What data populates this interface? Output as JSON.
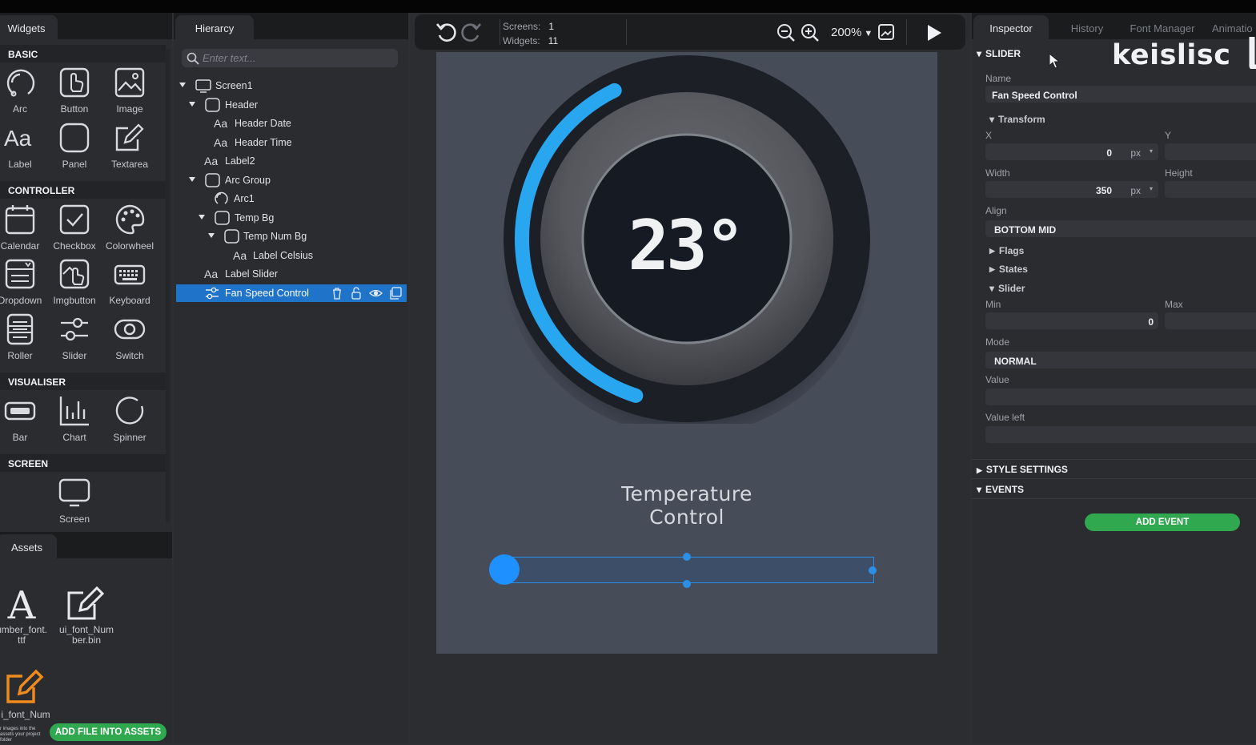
{
  "widgets": {
    "tab": "Widgets",
    "sections": {
      "basic": "BASIC",
      "controller": "CONTROLLER",
      "visualiser": "VISUALISER",
      "screen": "SCREEN"
    },
    "basic": [
      "Arc",
      "Button",
      "Image",
      "Label",
      "Panel",
      "Textarea"
    ],
    "controller": [
      "Calendar",
      "Checkbox",
      "Colorwheel",
      "Dropdown",
      "Imgbutton",
      "Keyboard",
      "Roller",
      "Slider",
      "Switch"
    ],
    "visualiser": [
      "Bar",
      "Chart",
      "Spinner"
    ],
    "screen": [
      "Screen"
    ]
  },
  "assets": {
    "tab": "Assets",
    "items": [
      {
        "name_line1": "umber_font.",
        "name_line2": "ttf"
      },
      {
        "name_line1": "ui_font_Num",
        "name_line2": "ber.bin"
      },
      {
        "name_line1": "i_font_Num",
        "name_line2": ""
      }
    ],
    "note": "r images into the assets your project folder",
    "add_button": "ADD FILE INTO ASSETS"
  },
  "hierarchy": {
    "tab": "Hierarcy",
    "search_placeholder": "Enter text...",
    "items": [
      {
        "label": "Screen1",
        "icon": "screen-icon"
      },
      {
        "label": "Header",
        "icon": "panel-icon"
      },
      {
        "label": "Header Date",
        "icon": "label-icon"
      },
      {
        "label": "Header Time",
        "icon": "label-icon"
      },
      {
        "label": "Label2",
        "icon": "label-icon"
      },
      {
        "label": "Arc Group",
        "icon": "panel-icon"
      },
      {
        "label": "Arc1",
        "icon": "arc-icon"
      },
      {
        "label": "Temp Bg",
        "icon": "panel-icon"
      },
      {
        "label": "Temp Num Bg",
        "icon": "panel-icon"
      },
      {
        "label": "Label Celsius",
        "icon": "label-icon"
      },
      {
        "label": "Label Slider",
        "icon": "label-icon"
      },
      {
        "label": "Fan Speed Control",
        "icon": "slider-icon",
        "selected": true
      }
    ]
  },
  "canvas": {
    "screens_label": "Screens:",
    "screens_value": "1",
    "widgets_label": "Widgets:",
    "widgets_value": "11",
    "zoom": "200%",
    "temperature": "23°",
    "title_line1": "Temperature",
    "title_line2": "Control",
    "arc_color": "#29a6f0",
    "accent": "#1e90ff"
  },
  "inspector": {
    "tabs": [
      "Inspector",
      "History",
      "Font Manager",
      "Animatio"
    ],
    "section": "SLIDER",
    "name_label": "Name",
    "name_value": "Fan Speed Control",
    "transform": "Transform",
    "x_label": "X",
    "x_value": "0",
    "x_unit": "px",
    "y_label": "Y",
    "width_label": "Width",
    "width_value": "350",
    "width_unit": "px",
    "height_label": "Height",
    "align_label": "Align",
    "align_value": "BOTTOM MID",
    "flags": "Flags",
    "states": "States",
    "slider": "Slider",
    "min_label": "Min",
    "min_value": "0",
    "max_label": "Max",
    "mode_label": "Mode",
    "mode_value": "NORMAL",
    "value_label": "Value",
    "value_left_label": "Value left",
    "style_settings": "STYLE SETTINGS",
    "events": "EVENTS",
    "add_event": "ADD EVENT",
    "watermark": "keislisc",
    "add_green": "#2fa84f"
  }
}
